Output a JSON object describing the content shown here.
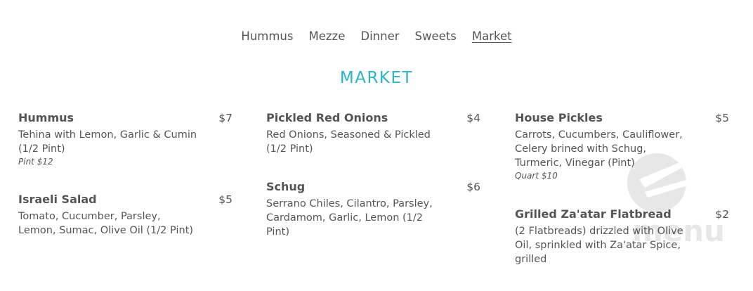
{
  "nav": {
    "items": [
      {
        "label": "Hummus"
      },
      {
        "label": "Mezze"
      },
      {
        "label": "Dinner"
      },
      {
        "label": "Sweets"
      },
      {
        "label": "Market",
        "active": true
      }
    ]
  },
  "section_title": "MARKET",
  "columns": [
    {
      "items": [
        {
          "name": "Hummus",
          "price": "$7",
          "description": "Tehina with Lemon, Garlic & Cumin (1/2 Pint)",
          "note": "Pint $12"
        },
        {
          "name": "Israeli Salad",
          "price": "$5",
          "description": "Tomato, Cucumber, Parsley, Lemon, Sumac, Olive Oil (1/2 Pint)"
        }
      ]
    },
    {
      "items": [
        {
          "name": "Pickled Red Onions",
          "price": "$4",
          "description": "Red Onions, Seasoned & Pickled (1/2 Pint)"
        },
        {
          "name": "Schug",
          "price": "$6",
          "description": "Serrano Chiles, Cilantro, Parsley, Cardamom, Garlic, Lemon (1/2 Pint)"
        }
      ]
    },
    {
      "items": [
        {
          "name": "House Pickles",
          "price": "$5",
          "description": "Carrots, Cucumbers, Cauliflower, Celery brined with Schug, Turmeric, Vinegar (Pint)",
          "note": "Quart $10"
        },
        {
          "name": "Grilled Za'atar Flatbread",
          "price": "$2",
          "description": "(2 Flatbreads) drizzled with Olive Oil, sprinkled with Za'atar Spice, grilled"
        }
      ]
    }
  ],
  "watermark": {
    "icon": "fork-knife-icon",
    "text": "Zmenu"
  },
  "colors": {
    "accent": "#2bb5c4",
    "text": "#555555"
  }
}
